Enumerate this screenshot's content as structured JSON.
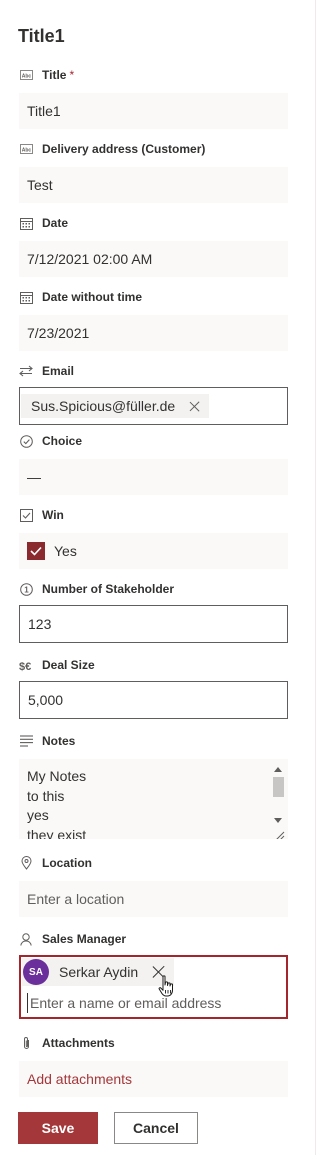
{
  "form": {
    "title": "Title1",
    "fields": {
      "title": {
        "label": "Title",
        "required_mark": "*",
        "value": "Title1",
        "icon": "text-field-icon"
      },
      "delivery": {
        "label": "Delivery address (Customer)",
        "value": "Test",
        "icon": "text-field-icon"
      },
      "date": {
        "label": "Date",
        "value": "7/12/2021 02:00 AM",
        "icon": "calendar-icon"
      },
      "date_no_time": {
        "label": "Date without time",
        "value": "7/23/2021",
        "icon": "calendar-icon"
      },
      "email": {
        "label": "Email",
        "value": "Sus.Spicious@füller.de",
        "icon": "lookup-arrows-icon"
      },
      "choice": {
        "label": "Choice",
        "value": "—",
        "icon": "choice-check-circle-icon"
      },
      "win": {
        "label": "Win",
        "checked": true,
        "value": "Yes",
        "icon": "checkbox-icon"
      },
      "stakeholder": {
        "label": "Number of Stakeholder",
        "value": "123",
        "icon": "number-icon"
      },
      "deal_size": {
        "label": "Deal Size",
        "value": "5,000",
        "icon": "currency-icon"
      },
      "notes": {
        "label": "Notes",
        "lines": [
          "My Notes",
          "to this",
          "yes",
          "they exist"
        ],
        "icon": "lines-icon"
      },
      "location": {
        "label": "Location",
        "placeholder": "Enter a location",
        "icon": "map-pin-icon"
      },
      "sales_manager": {
        "label": "Sales Manager",
        "person_initials": "SA",
        "person_name": "Serkar Aydin",
        "placeholder": "Enter a name or email address",
        "icon": "person-icon"
      },
      "attachments": {
        "label": "Attachments",
        "link": "Add attachments",
        "icon": "paperclip-icon"
      }
    },
    "actions": {
      "save": "Save",
      "cancel": "Cancel"
    }
  },
  "colors": {
    "accent": "#a4373a",
    "avatar": "#6b2f9b",
    "error_border": "#a4262c"
  }
}
